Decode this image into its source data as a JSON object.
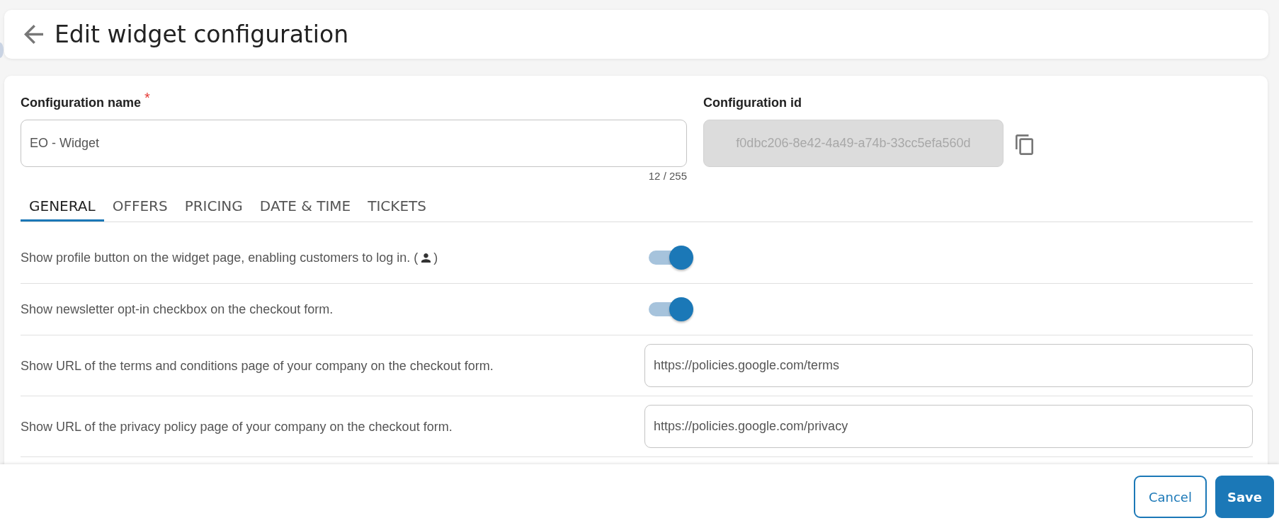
{
  "header": {
    "title": "Edit widget configuration"
  },
  "form": {
    "name_field": {
      "label": "Configuration name",
      "required_mark": "*",
      "value": "EO - Widget",
      "counter": "12 / 255"
    },
    "id_field": {
      "label": "Configuration id",
      "value": "f0dbc206-8e42-4a49-a74b-33cc5efa560d",
      "disabled": true
    }
  },
  "tabs": [
    {
      "label": "GENERAL",
      "selected": true
    },
    {
      "label": "OFFERS",
      "selected": false
    },
    {
      "label": "PRICING",
      "selected": false
    },
    {
      "label": "DATE & TIME",
      "selected": false
    },
    {
      "label": "TICKETS",
      "selected": false
    }
  ],
  "settings": [
    {
      "kind": "toggle",
      "label": "Show profile button on the widget page, enabling customers to log in.",
      "icon_hint": {
        "open": "(",
        "close": ")"
      },
      "on": true
    },
    {
      "kind": "toggle",
      "label": "Show newsletter opt-in checkbox on the checkout form.",
      "on": true
    },
    {
      "kind": "url",
      "label": "Show URL of the terms and conditions page of your company on the checkout form.",
      "value": "https://policies.google.com/terms"
    },
    {
      "kind": "url",
      "label": "Show URL of the privacy policy page of your company on the checkout form.",
      "value": "https://policies.google.com/privacy"
    }
  ],
  "footer": {
    "buttons": [
      {
        "label": "Cancel",
        "kind": "secondary"
      },
      {
        "label": "Save",
        "kind": "primary"
      }
    ]
  }
}
